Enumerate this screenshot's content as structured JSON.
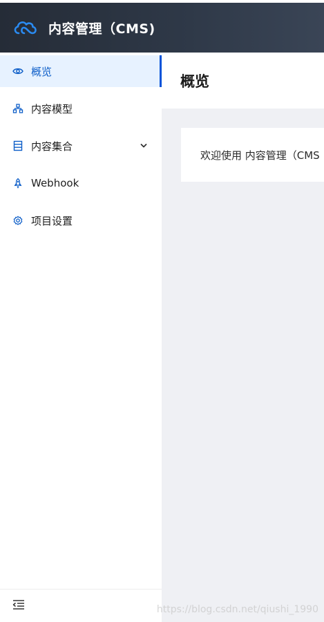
{
  "header": {
    "title": "内容管理（CMS)"
  },
  "sidebar": {
    "items": [
      {
        "label": "概览",
        "icon": "eye-icon",
        "active": true
      },
      {
        "label": "内容模型",
        "icon": "model-tree-icon",
        "active": false
      },
      {
        "label": "内容集合",
        "icon": "collection-icon",
        "active": false,
        "expandable": true
      },
      {
        "label": "Webhook",
        "icon": "rocket-icon",
        "active": false
      },
      {
        "label": "项目设置",
        "icon": "gear-icon",
        "active": false
      }
    ],
    "collapse_icon": "menu-fold-icon"
  },
  "main": {
    "title": "概览",
    "welcome_text": "欢迎使用 内容管理（CMS"
  },
  "watermark": "https://blog.csdn.net/qiushi_1990",
  "colors": {
    "accent": "#0052d9",
    "header_bg": "#2a3341",
    "active_bg": "#e7f2ff",
    "content_bg": "#eff0f4"
  }
}
